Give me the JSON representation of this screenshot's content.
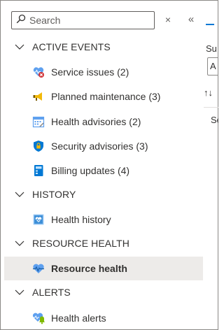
{
  "search": {
    "placeholder": "Search",
    "clear_glyph": "×",
    "collapse_glyph": "«"
  },
  "groups": [
    {
      "label": "ACTIVE EVENTS",
      "expanded": true
    },
    {
      "label": "HISTORY",
      "expanded": true
    },
    {
      "label": "RESOURCE HEALTH",
      "expanded": true
    },
    {
      "label": "ALERTS",
      "expanded": true
    }
  ],
  "items": {
    "service_issues": {
      "label": "Service issues (2)",
      "icon": "service-issues-icon"
    },
    "planned_maintenance": {
      "label": "Planned maintenance (3)",
      "icon": "megaphone-icon"
    },
    "health_advisories": {
      "label": "Health advisories (2)",
      "icon": "calendar-icon"
    },
    "security_advisories": {
      "label": "Security advisories (3)",
      "icon": "shield-icon"
    },
    "billing_updates": {
      "label": "Billing updates (4)",
      "icon": "billing-icon"
    },
    "health_history": {
      "label": "Health history",
      "icon": "health-history-icon"
    },
    "resource_health": {
      "label": "Resource health",
      "icon": "heart-pulse-icon",
      "selected": true
    },
    "health_alerts": {
      "label": "Health alerts",
      "icon": "health-alerts-icon"
    }
  },
  "right_panel": {
    "text1": "Su",
    "input_value": "A",
    "sort_glyph": "↑↓",
    "text2": "Se"
  },
  "colors": {
    "accent": "#0078d4",
    "selected_bg": "#edebe9",
    "error": "#d13438"
  }
}
